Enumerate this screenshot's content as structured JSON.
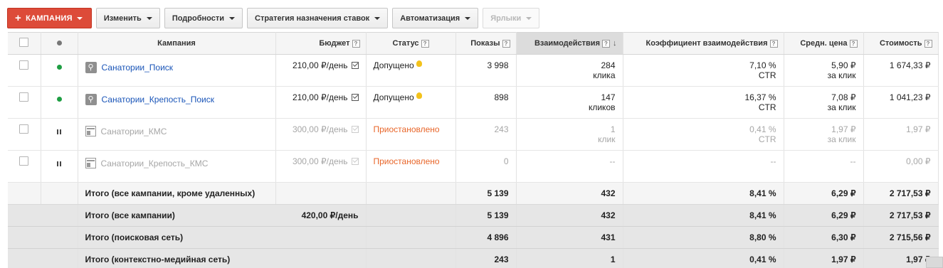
{
  "toolbar": {
    "add_campaign": "КАМПАНИЯ",
    "edit": "Изменить",
    "details": "Подробности",
    "bid_strategy": "Стратегия назначения ставок",
    "automation": "Автоматизация",
    "labels": "Ярлыки"
  },
  "columns": {
    "campaign": "Кампания",
    "budget": "Бюджет",
    "status": "Статус",
    "impressions": "Показы",
    "interactions": "Взаимодействия",
    "interaction_rate": "Коэффициент взаимодействия",
    "avg_cost": "Средн. цена",
    "cost": "Стоимость",
    "help": "?"
  },
  "rows": [
    {
      "name": "Санатории_Поиск",
      "budget": "210,00 ₽/день",
      "status": "Допущено",
      "impressions": "3 998",
      "interactions": "284",
      "interactions_unit": "клика",
      "rate": "7,10 %",
      "rate_unit": "CTR",
      "avg_cost": "5,90 ₽",
      "avg_cost_unit": "за клик",
      "cost": "1 674,33 ₽"
    },
    {
      "name": "Санатории_Крепость_Поиск",
      "budget": "210,00 ₽/день",
      "status": "Допущено",
      "impressions": "898",
      "interactions": "147",
      "interactions_unit": "кликов",
      "rate": "16,37 %",
      "rate_unit": "CTR",
      "avg_cost": "7,08 ₽",
      "avg_cost_unit": "за клик",
      "cost": "1 041,23 ₽"
    },
    {
      "name": "Санатории_КМС",
      "budget": "300,00 ₽/день",
      "status": "Приостановлено",
      "impressions": "243",
      "interactions": "1",
      "interactions_unit": "клик",
      "rate": "0,41 %",
      "rate_unit": "CTR",
      "avg_cost": "1,97 ₽",
      "avg_cost_unit": "за клик",
      "cost": "1,97 ₽"
    },
    {
      "name": "Санатории_Крепость_КМС",
      "budget": "300,00 ₽/день",
      "status": "Приостановлено",
      "impressions": "0",
      "interactions": "--",
      "interactions_unit": "",
      "rate": "--",
      "rate_unit": "",
      "avg_cost": "--",
      "avg_cost_unit": "",
      "cost": "0,00 ₽"
    }
  ],
  "totals": [
    {
      "label": "Итого (все кампании, кроме удаленных)",
      "budget": "",
      "impressions": "5 139",
      "interactions": "432",
      "rate": "8,41 %",
      "avg_cost": "6,29 ₽",
      "cost": "2 717,53 ₽"
    },
    {
      "label": "Итого (все кампании)",
      "budget": "420,00 ₽/день",
      "impressions": "5 139",
      "interactions": "432",
      "rate": "8,41 %",
      "avg_cost": "6,29 ₽",
      "cost": "2 717,53 ₽"
    },
    {
      "label": "Итого (поисковая сеть)",
      "budget": "",
      "impressions": "4 896",
      "interactions": "431",
      "rate": "8,80 %",
      "avg_cost": "6,30 ₽",
      "cost": "2 715,56 ₽"
    },
    {
      "label": "Итого (контекстно-медийная сеть)",
      "budget": "",
      "impressions": "243",
      "interactions": "1",
      "rate": "0,41 %",
      "avg_cost": "1,97 ₽",
      "cost": "1,97 ₽"
    }
  ],
  "colors": {
    "primary_button": "#dd4b39",
    "link": "#1a55b8",
    "enabled_dot": "#1e9e43",
    "paused_status": "#e8662a",
    "eligible_bulb": "#f3c21b"
  },
  "icons": {
    "search_campaign": "search-icon",
    "display_campaign": "display-network-icon",
    "budget": "budget-checkbox-icon",
    "status_hint": "lightbulb-icon",
    "sort": "arrow-down-icon"
  }
}
